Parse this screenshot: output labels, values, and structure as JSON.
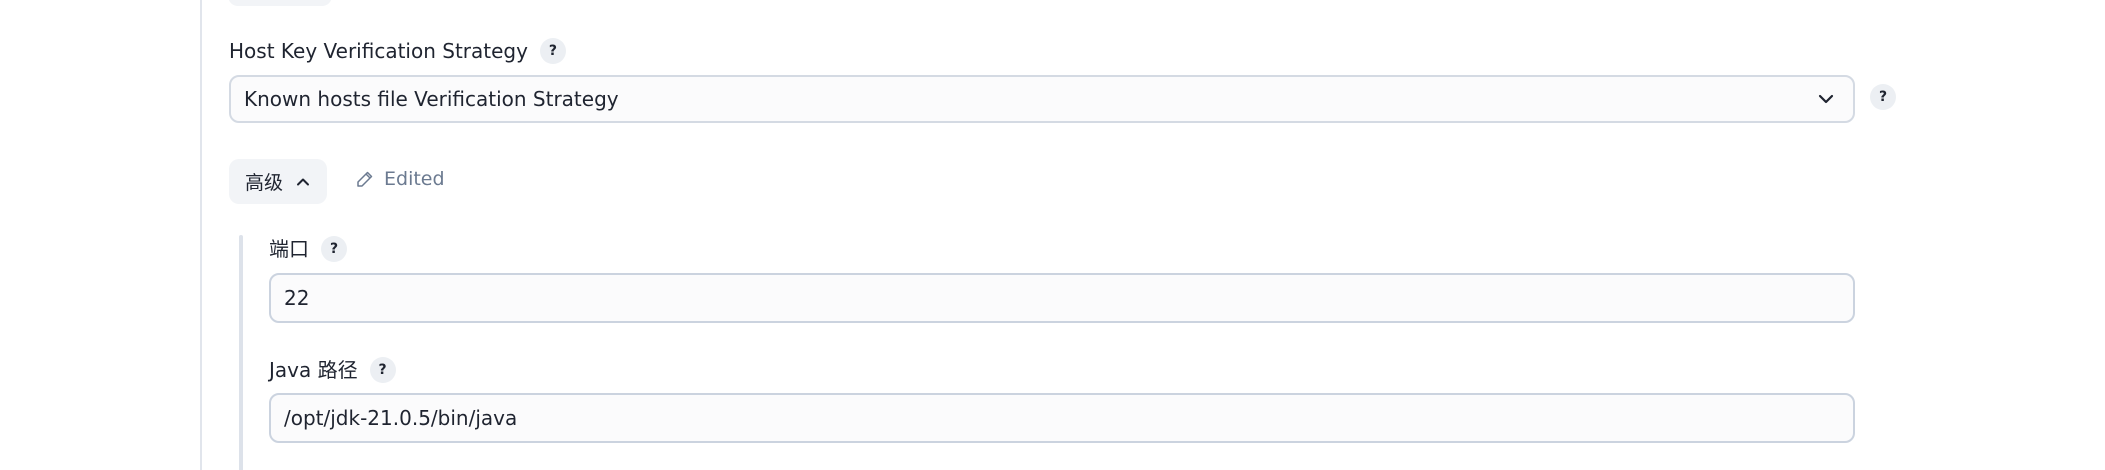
{
  "host_key": {
    "label": "Host Key Verification Strategy",
    "help": "?",
    "selected": "Known hosts file Verification Strategy",
    "outer_help": "?"
  },
  "advanced": {
    "label": "高级",
    "edited_label": "Edited"
  },
  "port": {
    "label": "端口",
    "help": "?",
    "value": "22"
  },
  "java_path": {
    "label": "Java 路径",
    "help": "?",
    "value": "/opt/jdk-21.0.5/bin/java"
  },
  "icons": {
    "select_chevron": "chevron-down-icon",
    "advanced_chevron": "chevron-up-icon",
    "edited": "pencil-icon"
  }
}
